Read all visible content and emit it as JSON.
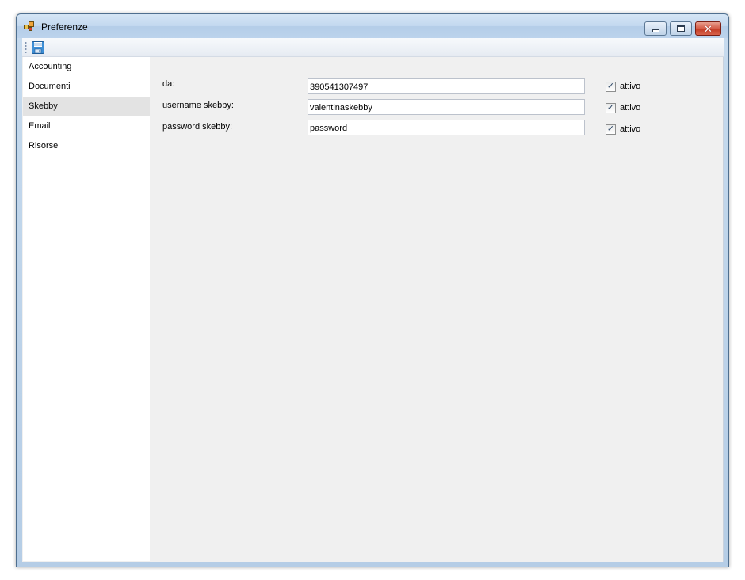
{
  "window": {
    "title": "Preferenze",
    "app_icon": "app-icon",
    "controls": {
      "minimize_icon": "minimize-icon",
      "maximize_icon": "maximize-icon",
      "close_icon": "close-icon"
    }
  },
  "toolbar": {
    "save_icon": "save-disk-icon"
  },
  "sidebar": {
    "items": [
      {
        "label": "Accounting"
      },
      {
        "label": "Documenti"
      },
      {
        "label": "Skebby"
      },
      {
        "label": "Email"
      },
      {
        "label": "Risorse"
      }
    ],
    "selected_index": 2
  },
  "form": {
    "fields": [
      {
        "label": "da:",
        "value": "390541307497",
        "enabled_label": "attivo",
        "enabled": true
      },
      {
        "label": "username skebby:",
        "value": "valentinaskebby",
        "enabled_label": "attivo",
        "enabled": true
      },
      {
        "label": "password skebby:",
        "value": "password",
        "enabled_label": "attivo",
        "enabled": true
      }
    ]
  },
  "colors": {
    "titlebar": "#c2d8ef",
    "content_bg": "#f0f0f0",
    "sidebar_bg": "#ffffff",
    "selected_item": "#e3e3e3",
    "close_button": "#c23a23"
  }
}
